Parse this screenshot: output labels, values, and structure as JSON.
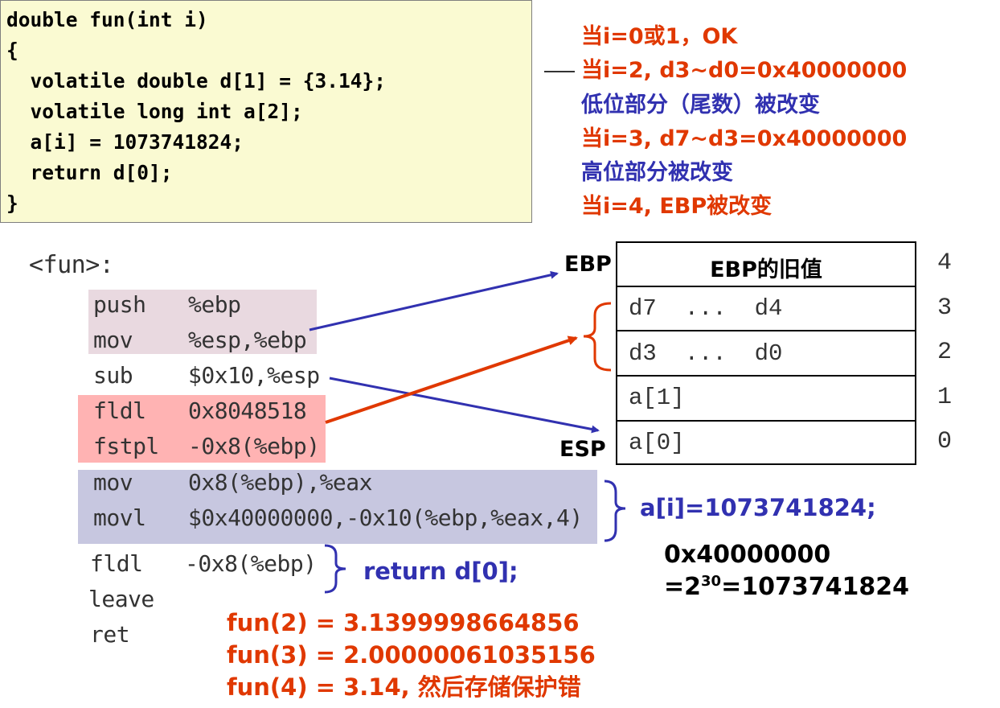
{
  "code": {
    "lines": [
      "double fun(int i)",
      "{",
      "  volatile double d[1] = {3.14};",
      "  volatile long int a[2];",
      "  a[i] = 1073741824;",
      "  return d[0];",
      "}"
    ]
  },
  "notes": [
    {
      "text": "当i=0或1，OK",
      "color": "#e03800"
    },
    {
      "text": "当i=2, d3~d0=0x40000000",
      "color": "#e03800"
    },
    {
      "text": "低位部分（尾数）被改变",
      "color": "#3131b0"
    },
    {
      "text": "当i=3, d7~d3=0x40000000",
      "color": "#e03800"
    },
    {
      "text": "高位部分被改变",
      "color": "#3131b0"
    },
    {
      "text": "当i=4, EBP被改变",
      "color": "#e03800"
    }
  ],
  "asm": {
    "label": "<fun>:",
    "rows": [
      {
        "op": "push",
        "arg": "%ebp"
      },
      {
        "op": "mov",
        "arg": "%esp,%ebp"
      },
      {
        "op": "sub",
        "arg": "$0x10,%esp"
      },
      {
        "op": "fldl",
        "arg": "0x8048518"
      },
      {
        "op": "fstpl",
        "arg": "-0x8(%ebp)"
      },
      {
        "op": "mov",
        "arg": "0x8(%ebp),%eax"
      },
      {
        "op": "movl",
        "arg": "$0x40000000,-0x10(%ebp,%eax,4)"
      },
      {
        "op": "fldl",
        "arg": "-0x8(%ebp)"
      },
      {
        "op": "leave",
        "arg": ""
      },
      {
        "op": "ret",
        "arg": ""
      }
    ]
  },
  "stack": {
    "ebp_label": "EBP",
    "esp_label": "ESP",
    "cells": [
      "EBP的旧值",
      "d7  ...  d4",
      "d3  ...  d0",
      "a[1]",
      "a[0]"
    ],
    "indices": [
      "4",
      "3",
      "2",
      "1",
      "0"
    ]
  },
  "annotations": {
    "assign": "a[i]=1073741824;",
    "return": "return d[0];",
    "hex_line1": "0x40000000",
    "hex_line2_prefix": "=2",
    "hex_exponent": "30",
    "hex_line2_suffix": "=1073741824"
  },
  "results": [
    "fun(2) = 3.1399998664856",
    "fun(3) = 2.00000061035156",
    "fun(4) = 3.14, 然后存储保护错"
  ],
  "colors": {
    "red": "#e03800",
    "blue": "#3131b0",
    "code_bg": "#fafad2",
    "pink_bg": "#e9d9e0",
    "salmon_bg": "#ffb3b3",
    "lavender_bg": "#c7c7e0"
  }
}
